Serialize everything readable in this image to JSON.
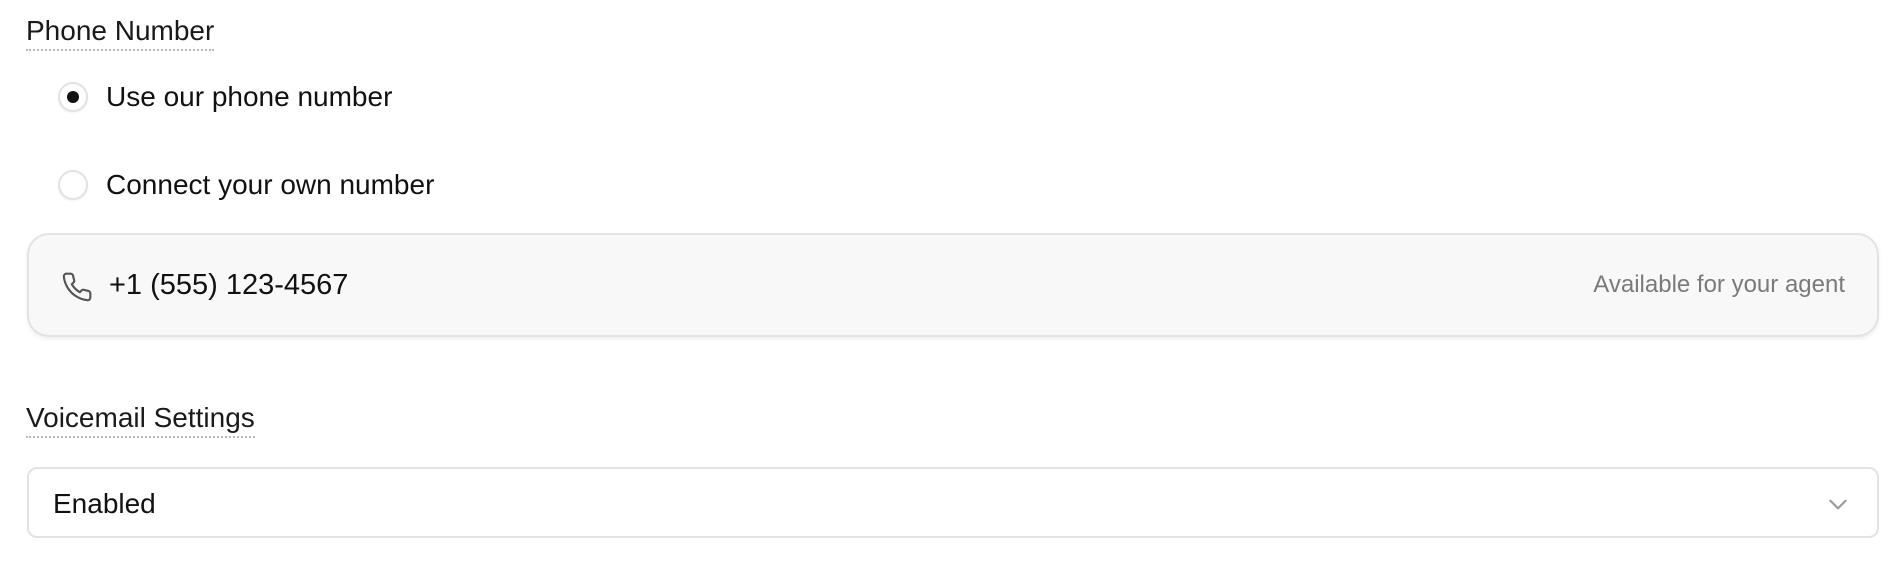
{
  "phone_number_section": {
    "label": "Phone Number",
    "options": [
      {
        "label": "Use our phone number",
        "selected": true
      },
      {
        "label": "Connect your own number",
        "selected": false
      }
    ],
    "card": {
      "icon": "phone-icon",
      "number": "+1 (555) 123-4567",
      "status": "Available for your agent"
    }
  },
  "voicemail_section": {
    "label": "Voicemail Settings",
    "select": {
      "value": "Enabled",
      "icon": "chevron-down-icon"
    }
  },
  "colors": {
    "text_primary": "#111111",
    "text_muted": "#7a7a7a",
    "card_background": "#f8f8f8",
    "border": "#e3e3e3"
  }
}
